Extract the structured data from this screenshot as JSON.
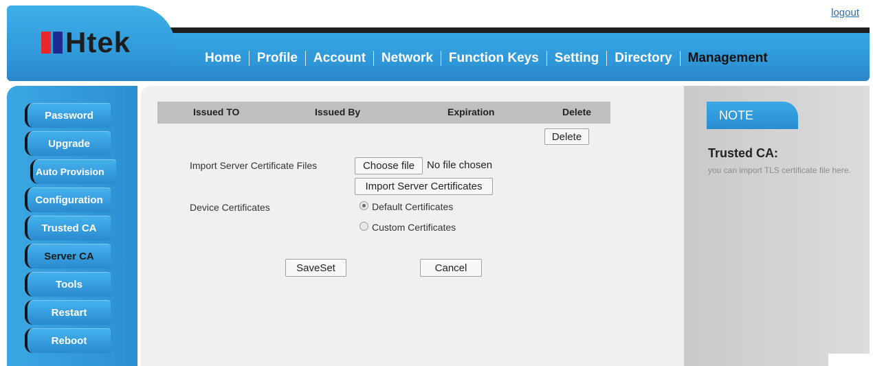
{
  "header": {
    "logout_label": "logout",
    "logo_text": "Htek",
    "nav": [
      {
        "label": "Home"
      },
      {
        "label": "Profile"
      },
      {
        "label": "Account"
      },
      {
        "label": "Network"
      },
      {
        "label": "Function Keys"
      },
      {
        "label": "Setting"
      },
      {
        "label": "Directory"
      },
      {
        "label": "Management",
        "active": true
      }
    ]
  },
  "sidebar": {
    "items": [
      {
        "label": "Password"
      },
      {
        "label": "Upgrade"
      },
      {
        "label": "Auto Provision"
      },
      {
        "label": "Configuration"
      },
      {
        "label": "Trusted CA"
      },
      {
        "label": "Server CA"
      },
      {
        "label": "Tools"
      },
      {
        "label": "Restart"
      },
      {
        "label": "Reboot"
      }
    ]
  },
  "main": {
    "table": {
      "columns": [
        "Issued TO",
        "Issued By",
        "Expiration",
        "Delete"
      ],
      "delete_button": "Delete"
    },
    "import_label": "Import Server Certificate Files",
    "choose_file_button": "Choose file",
    "file_status": "No file chosen",
    "import_button": "Import Server Certificates",
    "device_cert_label": "Device Certificates",
    "radio_options": [
      {
        "label": "Default Certificates",
        "checked": true
      },
      {
        "label": "Custom Certificates",
        "checked": false
      }
    ],
    "save_button": "SaveSet",
    "cancel_button": "Cancel"
  },
  "note": {
    "tab_label": "NOTE",
    "title": "Trusted CA:",
    "text": "you can import TLS certificate file here."
  },
  "colors": {
    "brand_blue": "#2f97d8",
    "logo_red": "#e8282b",
    "logo_navy": "#1d2a8f"
  }
}
